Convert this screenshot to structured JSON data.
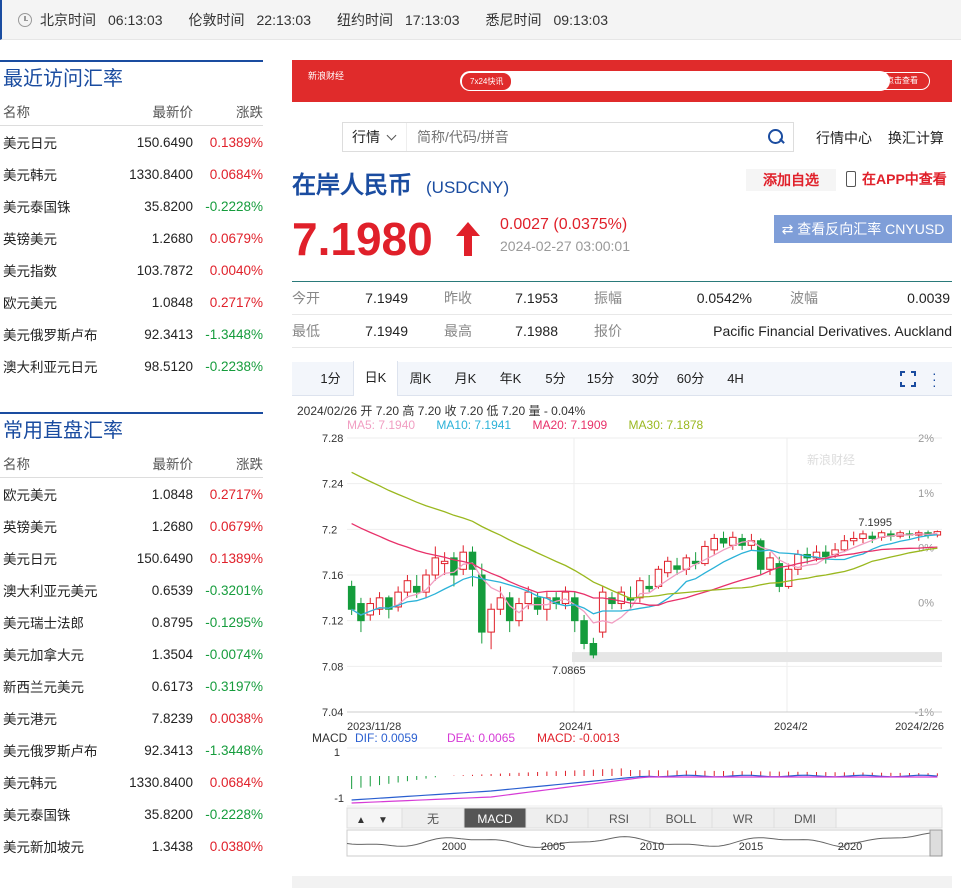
{
  "timebar": [
    {
      "city": "北京时间",
      "time": "06:13:03"
    },
    {
      "city": "伦敦时间",
      "time": "22:13:03"
    },
    {
      "city": "纽约时间",
      "time": "17:13:03"
    },
    {
      "city": "悉尼时间",
      "time": "09:13:03"
    }
  ],
  "recent": {
    "title": "最近访问汇率",
    "headers": {
      "name": "名称",
      "price": "最新价",
      "chg": "涨跌"
    },
    "rows": [
      {
        "name": "美元日元",
        "price": "150.6490",
        "chg": "0.1389%",
        "dir": "up"
      },
      {
        "name": "美元韩元",
        "price": "1330.8400",
        "chg": "0.0684%",
        "dir": "up"
      },
      {
        "name": "美元泰国铢",
        "price": "35.8200",
        "chg": "-0.2228%",
        "dir": "down"
      },
      {
        "name": "英镑美元",
        "price": "1.2680",
        "chg": "0.0679%",
        "dir": "up"
      },
      {
        "name": "美元指数",
        "price": "103.7872",
        "chg": "0.0040%",
        "dir": "up"
      },
      {
        "name": "欧元美元",
        "price": "1.0848",
        "chg": "0.2717%",
        "dir": "up"
      },
      {
        "name": "美元俄罗斯卢布",
        "price": "92.3413",
        "chg": "-1.3448%",
        "dir": "down"
      },
      {
        "name": "澳大利亚元日元",
        "price": "98.5120",
        "chg": "-0.2238%",
        "dir": "down"
      }
    ]
  },
  "common": {
    "title": "常用直盘汇率",
    "headers": {
      "name": "名称",
      "price": "最新价",
      "chg": "涨跌"
    },
    "rows": [
      {
        "name": "欧元美元",
        "price": "1.0848",
        "chg": "0.2717%",
        "dir": "up"
      },
      {
        "name": "英镑美元",
        "price": "1.2680",
        "chg": "0.0679%",
        "dir": "up"
      },
      {
        "name": "美元日元",
        "price": "150.6490",
        "chg": "0.1389%",
        "dir": "up"
      },
      {
        "name": "澳大利亚元美元",
        "price": "0.6539",
        "chg": "-0.3201%",
        "dir": "down"
      },
      {
        "name": "美元瑞士法郎",
        "price": "0.8795",
        "chg": "-0.1295%",
        "dir": "down"
      },
      {
        "name": "美元加拿大元",
        "price": "1.3504",
        "chg": "-0.0074%",
        "dir": "down"
      },
      {
        "name": "新西兰元美元",
        "price": "0.6173",
        "chg": "-0.3197%",
        "dir": "down"
      },
      {
        "name": "美元港元",
        "price": "7.8239",
        "chg": "0.0038%",
        "dir": "up"
      },
      {
        "name": "美元俄罗斯卢布",
        "price": "92.3413",
        "chg": "-1.3448%",
        "dir": "down"
      },
      {
        "name": "美元韩元",
        "price": "1330.8400",
        "chg": "0.0684%",
        "dir": "up"
      },
      {
        "name": "美元泰国铢",
        "price": "35.8200",
        "chg": "-0.2228%",
        "dir": "down"
      },
      {
        "name": "美元新加坡元",
        "price": "1.3438",
        "chg": "0.0380%",
        "dir": "up"
      }
    ]
  },
  "banner": {
    "logo": "新浪财经",
    "tag": "7x24快讯",
    "button": "点击查看"
  },
  "search": {
    "type": "行情",
    "placeholder": "简称/代码/拼音"
  },
  "links": {
    "market": "行情中心",
    "calc": "换汇计算"
  },
  "quote": {
    "name": "在岸人民币",
    "code": "(USDCNY)",
    "add_fav": "添加自选",
    "app": "在APP中查看",
    "price": "7.1980",
    "change": "0.0027 (0.0375%)",
    "timestamp": "2024-02-27 03:00:01",
    "reverse": "查看反向汇率 CNYUSD"
  },
  "stats": {
    "open_label": "今开",
    "open": "7.1949",
    "prev_label": "昨收",
    "prev": "7.1953",
    "amp_label": "振幅",
    "amp": "0.0542%",
    "wave_label": "波幅",
    "wave": "0.0039",
    "low_label": "最低",
    "low": "7.1949",
    "high_label": "最高",
    "high": "7.1988",
    "source_label": "报价",
    "source": "Pacific Financial Derivatives. Auckland"
  },
  "periods": [
    "1分",
    "日K",
    "周K",
    "月K",
    "年K",
    "5分",
    "15分",
    "30分",
    "60分",
    "4H"
  ],
  "active_period": "日K",
  "legend": {
    "bar": "2024/02/26 开 7.20 高 7.20 收 7.20 低 7.20 量 - 0.04%",
    "ma5": "MA5: 7.1940",
    "ma10": "MA10: 7.1941",
    "ma20": "MA20: 7.1909",
    "ma30": "MA30: 7.1878",
    "macd_label": "MACD",
    "dif": "DIF: 0.0059",
    "dea": "DEA: 0.0065",
    "macd": "MACD: -0.0013"
  },
  "colors": {
    "up": "#e0202a",
    "down": "#159c3c",
    "brand": "#1a4ca0",
    "ma5": "#f19ec2",
    "ma10": "#2bb2d8",
    "ma20": "#e8316a",
    "ma30": "#9ab81f"
  },
  "chart_data": {
    "type": "candlestick",
    "ylim": [
      7.04,
      7.28
    ],
    "y_ticks": [
      "7.28",
      "7.24",
      "7.2",
      "7.16",
      "7.12",
      "7.08",
      "7.04"
    ],
    "pct_ticks": [
      "2%",
      "1%",
      "0%",
      "0%",
      "-1%",
      "-1%"
    ],
    "x_labels": [
      "2023/11/28",
      "2024/1",
      "2024/2",
      "2024/2/26"
    ],
    "max_label": "7.1995",
    "min_label": "7.0865",
    "candles": [
      [
        7.15,
        7.13,
        7.155,
        7.125
      ],
      [
        7.135,
        7.12,
        7.14,
        7.11
      ],
      [
        7.125,
        7.135,
        7.14,
        7.12
      ],
      [
        7.13,
        7.14,
        7.145,
        7.125
      ],
      [
        7.14,
        7.13,
        7.142,
        7.122
      ],
      [
        7.132,
        7.145,
        7.15,
        7.128
      ],
      [
        7.145,
        7.155,
        7.16,
        7.14
      ],
      [
        7.15,
        7.145,
        7.16,
        7.14
      ],
      [
        7.145,
        7.16,
        7.165,
        7.14
      ],
      [
        7.16,
        7.175,
        7.185,
        7.155
      ],
      [
        7.17,
        7.172,
        7.18,
        7.16
      ],
      [
        7.175,
        7.16,
        7.18,
        7.15
      ],
      [
        7.165,
        7.18,
        7.186,
        7.16
      ],
      [
        7.18,
        7.165,
        7.185,
        7.15
      ],
      [
        7.16,
        7.11,
        7.17,
        7.1
      ],
      [
        7.11,
        7.13,
        7.135,
        7.095
      ],
      [
        7.13,
        7.14,
        7.15,
        7.125
      ],
      [
        7.14,
        7.12,
        7.145,
        7.11
      ],
      [
        7.12,
        7.135,
        7.14,
        7.115
      ],
      [
        7.135,
        7.145,
        7.15,
        7.13
      ],
      [
        7.14,
        7.13,
        7.145,
        7.125
      ],
      [
        7.13,
        7.14,
        7.145,
        7.12
      ],
      [
        7.14,
        7.135,
        7.145,
        7.13
      ],
      [
        7.135,
        7.145,
        7.15,
        7.13
      ],
      [
        7.14,
        7.12,
        7.145,
        7.11
      ],
      [
        7.12,
        7.1,
        7.125,
        7.095
      ],
      [
        7.1,
        7.09,
        7.105,
        7.087
      ],
      [
        7.11,
        7.145,
        7.15,
        7.105
      ],
      [
        7.14,
        7.135,
        7.145,
        7.13
      ],
      [
        7.135,
        7.145,
        7.15,
        7.13
      ],
      [
        7.14,
        7.138,
        7.15,
        7.13
      ],
      [
        7.14,
        7.155,
        7.158,
        7.136
      ],
      [
        7.15,
        7.148,
        7.16,
        7.145
      ],
      [
        7.15,
        7.165,
        7.168,
        7.148
      ],
      [
        7.162,
        7.172,
        7.176,
        7.158
      ],
      [
        7.168,
        7.165,
        7.175,
        7.16
      ],
      [
        7.165,
        7.175,
        7.178,
        7.16
      ],
      [
        7.172,
        7.17,
        7.18,
        7.165
      ],
      [
        7.17,
        7.185,
        7.19,
        7.168
      ],
      [
        7.182,
        7.192,
        7.196,
        7.178
      ],
      [
        7.192,
        7.188,
        7.198,
        7.184
      ],
      [
        7.186,
        7.193,
        7.198,
        7.182
      ],
      [
        7.192,
        7.186,
        7.196,
        7.182
      ],
      [
        7.186,
        7.19,
        7.196,
        7.182
      ],
      [
        7.19,
        7.165,
        7.192,
        7.16
      ],
      [
        7.165,
        7.175,
        7.18,
        7.16
      ],
      [
        7.17,
        7.15,
        7.176,
        7.145
      ],
      [
        7.15,
        7.165,
        7.17,
        7.148
      ],
      [
        7.165,
        7.178,
        7.182,
        7.16
      ],
      [
        7.178,
        7.175,
        7.184,
        7.17
      ],
      [
        7.175,
        7.18,
        7.186,
        7.172
      ],
      [
        7.18,
        7.176,
        7.186,
        7.17
      ],
      [
        7.178,
        7.182,
        7.188,
        7.175
      ],
      [
        7.182,
        7.19,
        7.195,
        7.18
      ],
      [
        7.19,
        7.192,
        7.198,
        7.186
      ],
      [
        7.192,
        7.196,
        7.199,
        7.188
      ],
      [
        7.194,
        7.192,
        7.198,
        7.188
      ],
      [
        7.193,
        7.197,
        7.199,
        7.19
      ],
      [
        7.196,
        7.194,
        7.199,
        7.19
      ],
      [
        7.194,
        7.197,
        7.199,
        7.192
      ],
      [
        7.196,
        7.195,
        7.199,
        7.192
      ],
      [
        7.195,
        7.197,
        7.199,
        7.19
      ],
      [
        7.197,
        7.195,
        7.199,
        7.192
      ],
      [
        7.195,
        7.198,
        7.199,
        7.193
      ]
    ]
  },
  "macd_ticks": [
    "1",
    "-1"
  ],
  "indicators": [
    "无",
    "MACD",
    "KDJ",
    "RSI",
    "BOLL",
    "WR",
    "DMI"
  ],
  "active_indicator": "MACD",
  "nav_years": [
    "2000",
    "2005",
    "2010",
    "2015",
    "2020"
  ]
}
